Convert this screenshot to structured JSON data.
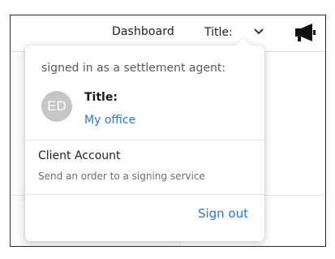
{
  "header": {
    "dashboard_label": "Dashboard",
    "title_label": "Title:",
    "chevron_icon": "chevron-down-icon",
    "announce_icon": "megaphone-icon"
  },
  "account_menu": {
    "signed_in_text": "signed in as a settlement agent:",
    "avatar_initials": "ED",
    "user_title": "Title:",
    "office_link": "My office",
    "client_account": {
      "title": "Client Account",
      "description": "Send an order to a signing service"
    },
    "sign_out_label": "Sign out"
  },
  "colors": {
    "link": "#2b78d6",
    "avatar_bg": "#c6c6c6",
    "text": "#1f1f1f",
    "muted": "#6d6d6d"
  }
}
